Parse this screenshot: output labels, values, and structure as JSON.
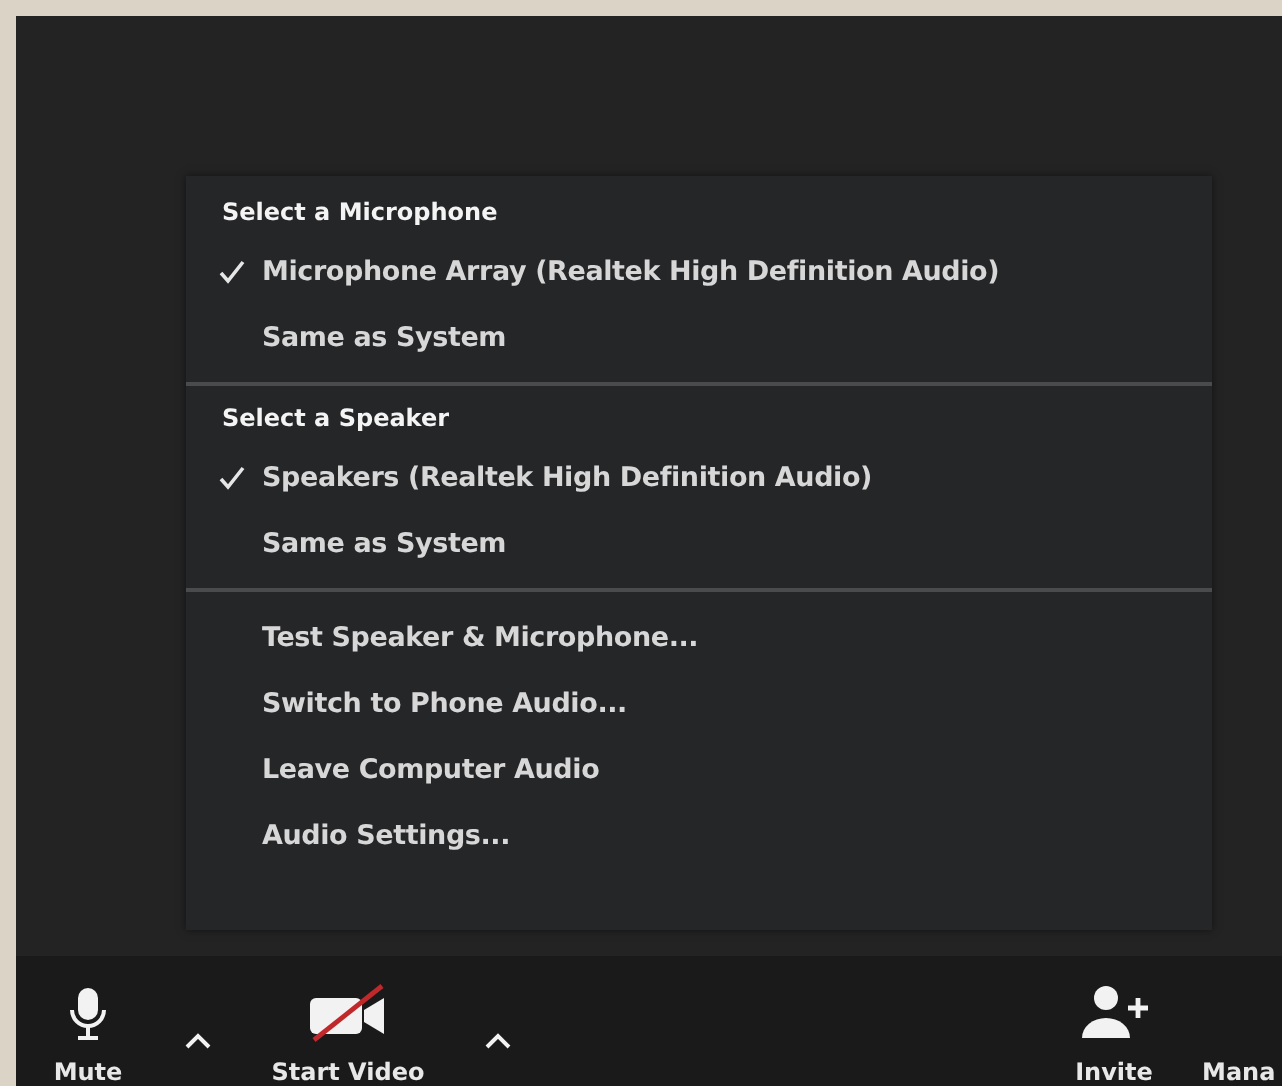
{
  "menu": {
    "sections": [
      {
        "header": "Select a Microphone",
        "items": [
          {
            "label": "Microphone Array (Realtek High Definition Audio)",
            "checked": true
          },
          {
            "label": "Same as System",
            "checked": false
          }
        ]
      },
      {
        "header": "Select a Speaker",
        "items": [
          {
            "label": "Speakers (Realtek High Definition Audio)",
            "checked": true
          },
          {
            "label": "Same as System",
            "checked": false
          }
        ]
      },
      {
        "items": [
          {
            "label": "Test Speaker & Microphone...",
            "checked": false
          },
          {
            "label": "Switch to Phone Audio...",
            "checked": false
          },
          {
            "label": "Leave Computer Audio",
            "checked": false
          },
          {
            "label": "Audio Settings...",
            "checked": false
          }
        ]
      }
    ]
  },
  "toolbar": [
    {
      "kind": "mic",
      "label": "Mute"
    },
    {
      "kind": "caret"
    },
    {
      "kind": "video",
      "label": "Start Video"
    },
    {
      "kind": "caret"
    },
    {
      "kind": "spacer"
    },
    {
      "kind": "invite",
      "label": "Invite"
    },
    {
      "kind": "text",
      "label": "Mana"
    }
  ]
}
